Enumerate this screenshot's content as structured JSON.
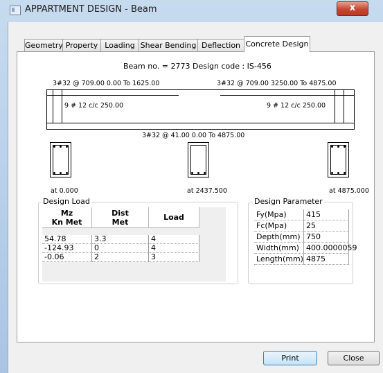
{
  "window": {
    "title": "APPARTMENT DESIGN - Beam",
    "close_glyph": "x"
  },
  "tabs": [
    "Geometry",
    "Property",
    "Loading",
    "Shear Bending",
    "Deflection",
    "Concrete Design"
  ],
  "header": {
    "text": "Beam no. = 2773  Design code :  IS-456"
  },
  "beam": {
    "top_left": "3#32 @ 709.00 0.00 To 1625.00",
    "top_right": "3#32 @ 709.00 3250.00 To 4875.00",
    "stirrup_left": "9 # 12 c/c 250.00",
    "stirrup_right": "9 # 12 c/c 250.00",
    "bottom": "3#32 @ 41.00 0.00 To 4875.00"
  },
  "sections": [
    "at 0.000",
    "at 2437.500",
    "at 4875.000"
  ],
  "design_load": {
    "title": "Design Load",
    "headers": [
      [
        "Mz",
        "Kn Met"
      ],
      [
        "Dist",
        "Met"
      ],
      [
        "Load"
      ]
    ],
    "rows": [
      [
        "54.78",
        "3.3",
        "4"
      ],
      [
        "-124.93",
        "0",
        "4"
      ],
      [
        "-0.06",
        "2",
        "3"
      ]
    ]
  },
  "design_parameter": {
    "title": "Design Parameter",
    "rows": [
      [
        "Fy(Mpa)",
        "415"
      ],
      [
        "Fc(Mpa)",
        "25"
      ],
      [
        "Depth(mm)",
        "750"
      ],
      [
        "Width(mm)",
        "400.0000059"
      ],
      [
        "Length(mm)",
        "4875"
      ]
    ]
  },
  "buttons": {
    "print": "Print",
    "close": "Close"
  }
}
